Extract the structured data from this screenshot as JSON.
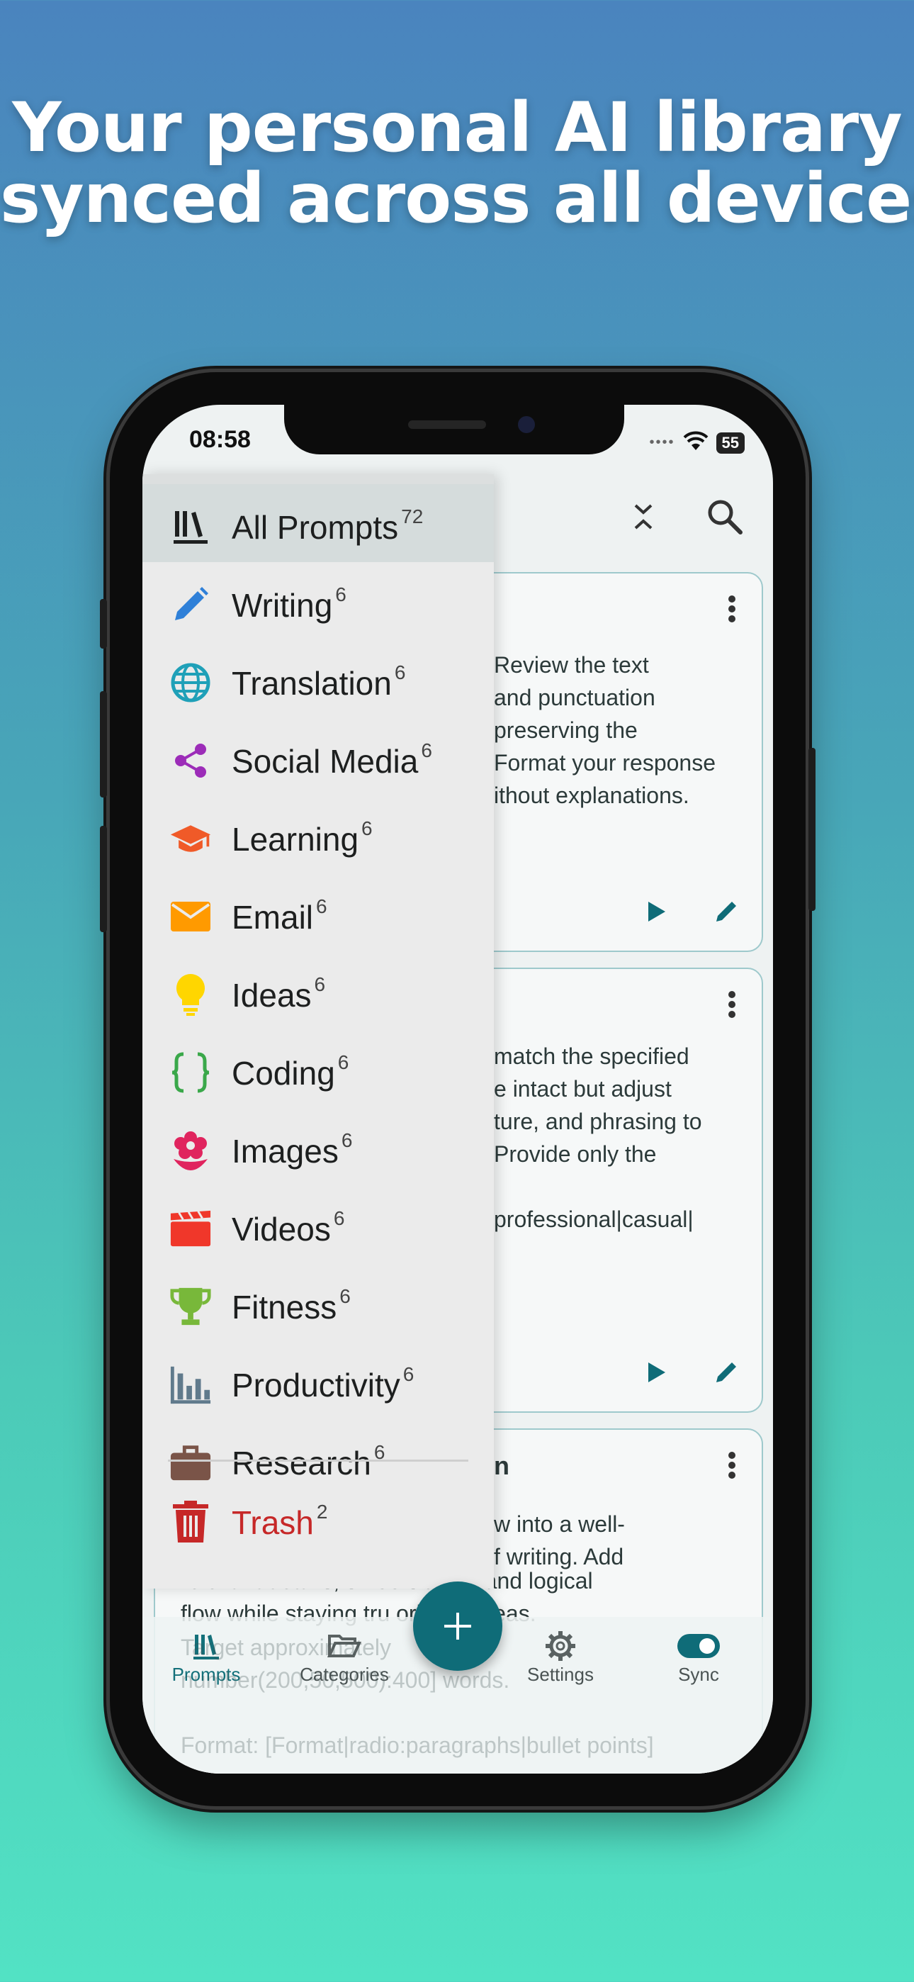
{
  "headline": [
    "Your personal AI library",
    "synced across all devices"
  ],
  "status": {
    "time": "08:58",
    "battery": "55"
  },
  "menu": {
    "items": [
      {
        "label": "All Prompts",
        "count": "72",
        "icon": "library-icon",
        "color": "#1d1f1f"
      },
      {
        "label": "Writing",
        "count": "6",
        "icon": "pencil-icon",
        "color": "#2f80d8"
      },
      {
        "label": "Translation",
        "count": "6",
        "icon": "globe-icon",
        "color": "#1fa0b8"
      },
      {
        "label": "Social Media",
        "count": "6",
        "icon": "share-icon",
        "color": "#9c2cb8"
      },
      {
        "label": "Learning",
        "count": "6",
        "icon": "graduation-cap-icon",
        "color": "#f05a28"
      },
      {
        "label": "Email",
        "count": "6",
        "icon": "envelope-icon",
        "color": "#ff9a00"
      },
      {
        "label": "Ideas",
        "count": "6",
        "icon": "lightbulb-icon",
        "color": "#ffd600"
      },
      {
        "label": "Coding",
        "count": "6",
        "icon": "braces-icon",
        "color": "#3aa84a"
      },
      {
        "label": "Images",
        "count": "6",
        "icon": "flower-icon",
        "color": "#e0245e"
      },
      {
        "label": "Videos",
        "count": "6",
        "icon": "clapperboard-icon",
        "color": "#f0372a"
      },
      {
        "label": "Fitness",
        "count": "6",
        "icon": "trophy-icon",
        "color": "#78b83a"
      },
      {
        "label": "Productivity",
        "count": "6",
        "icon": "bar-chart-icon",
        "color": "#607a8c"
      },
      {
        "label": "Research",
        "count": "6",
        "icon": "briefcase-icon",
        "color": "#7a5448"
      }
    ],
    "trash": {
      "label": "Trash",
      "count": "2",
      "icon": "trash-icon",
      "color": "#c62828"
    }
  },
  "cards": [
    {
      "lines": [
        "Review the text",
        "and punctuation",
        "preserving the",
        "Format your response",
        "ithout explanations."
      ]
    },
    {
      "lines": [
        "match the specified",
        "e intact but adjust",
        "ture, and phrasing to",
        "Provide only the",
        "",
        "professional|casual|"
      ]
    },
    {
      "title_fragment": "n",
      "lines": [
        "w into a well-",
        "f writing. Add"
      ]
    }
  ],
  "behind_lines": [
    "relevant details, smoo      sitions, and logical",
    "flow while staying tru        original ideas.",
    "Target approximately",
    "number(200,50,500):400] words.",
    "Format: [Format|radio:paragraphs|bullet points]"
  ],
  "nav": {
    "prompts": "Prompts",
    "categories": "Categories",
    "settings": "Settings",
    "sync": "Sync"
  },
  "colors": {
    "accent": "#0f6c78",
    "trash": "#c62828"
  }
}
